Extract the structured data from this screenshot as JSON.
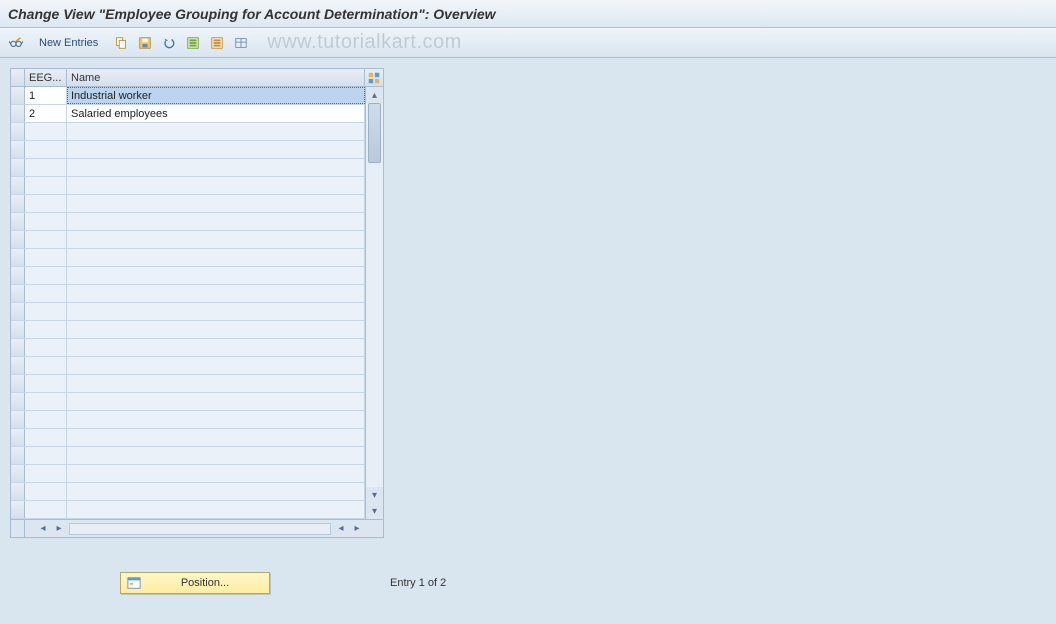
{
  "title": "Change View \"Employee Grouping for Account Determination\": Overview",
  "toolbar": {
    "new_entries_label": "New Entries"
  },
  "watermark": "www.tutorialkart.com",
  "grid": {
    "columns": {
      "eeg": "EEG...",
      "name": "Name"
    },
    "rows": [
      {
        "eeg": "1",
        "name": "Industrial worker",
        "selected": true
      },
      {
        "eeg": "2",
        "name": "Salaried employees",
        "selected": false
      }
    ],
    "empty_row_count": 22
  },
  "footer": {
    "position_label": "Position...",
    "entry_text": "Entry 1 of 2"
  }
}
